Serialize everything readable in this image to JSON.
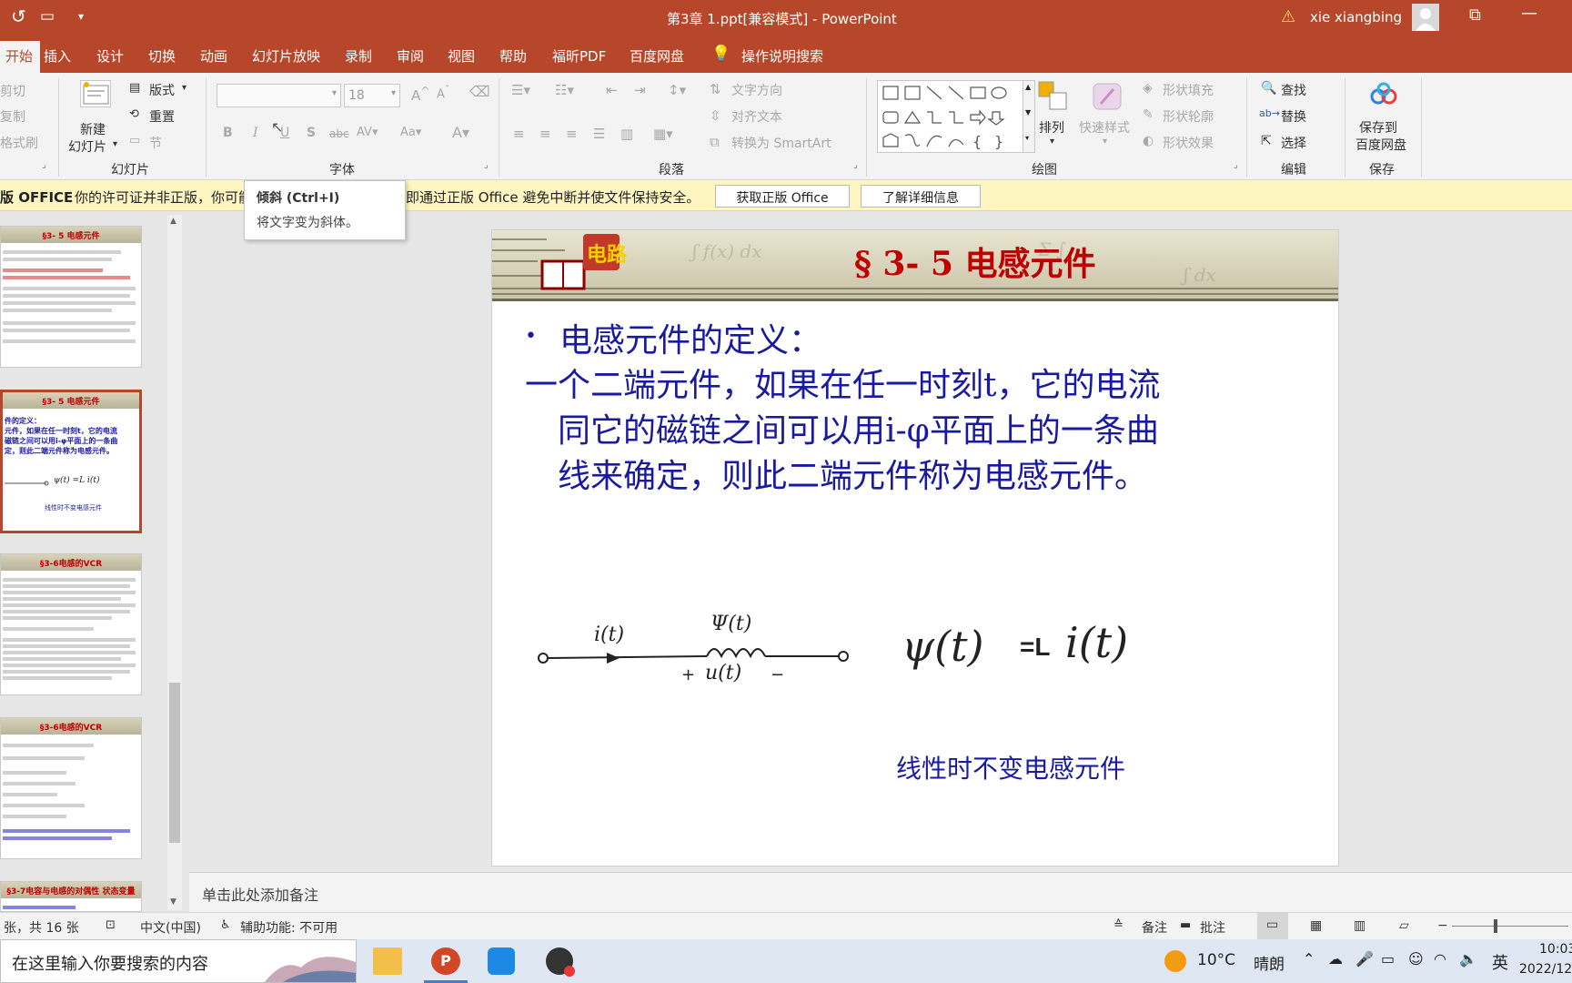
{
  "title_bar": {
    "document_title": "第3章 1.ppt[兼容模式]  -  PowerPoint",
    "user": "xie xiangbing"
  },
  "tabs": [
    "开始",
    "插入",
    "设计",
    "切换",
    "动画",
    "幻灯片放映",
    "录制",
    "审阅",
    "视图",
    "帮助",
    "福昕PDF",
    "百度网盘",
    "操作说明搜索"
  ],
  "ribbon": {
    "clipboard": {
      "cut": "剪切",
      "copy": "复制",
      "format_painter": "格式刷"
    },
    "slides": {
      "new_slide_1": "新建",
      "new_slide_2": "幻灯片",
      "layout": "版式",
      "reset": "重置",
      "section": "节",
      "group_label": "幻灯片"
    },
    "font": {
      "size": "18",
      "group_label": "字体"
    },
    "paragraph": {
      "text_direction": "文字方向",
      "align_text": "对齐文本",
      "smartart": "转换为 SmartArt",
      "group_label": "段落"
    },
    "drawing": {
      "arrange": "排列",
      "quick_styles": "快速样式",
      "shape_fill": "形状填充",
      "shape_outline": "形状轮廓",
      "shape_effects": "形状效果",
      "group_label": "绘图"
    },
    "editing": {
      "find": "查找",
      "replace": "替换",
      "select": "选择",
      "group_label": "编辑"
    },
    "save": {
      "save_to_1": "保存到",
      "save_to_2": "百度网盘",
      "group_label": "保存"
    }
  },
  "license_bar": {
    "label": "版 OFFICE",
    "message_a": "你的许可证并非正版，你可能",
    "message_b": "即通过正版 Office 避免中断并使文件保持安全。",
    "get_genuine": "获取正版 Office",
    "learn_more": "了解详细信息"
  },
  "tooltip": {
    "title": "倾斜 (Ctrl+I)",
    "desc": "将文字变为斜体。"
  },
  "thumbnails": [
    {
      "title": "§3- 5 电感元件"
    },
    {
      "title": "§3- 5 电感元件",
      "l1": "件的定义：",
      "l2": "元件，如果在任一时刻t，它的电流",
      "l3": "磁链之间可以用i-φ平面上的一条曲",
      "l4": "定，则此二端元件称为电感元件。",
      "formula": "ψ(t) =L i(t)",
      "caption": "线性时不变电感元件"
    },
    {
      "title": "§3-6电感的VCR"
    },
    {
      "title": "§3-6电感的VCR"
    },
    {
      "title": "§3-7电容与电感的对偶性 状态变量"
    }
  ],
  "slide": {
    "title": "§ 3- 5 电感元件",
    "bullet": "电感元件的定义：",
    "para_line1": "一个二端元件，如果在任一时刻t，它的电流",
    "para_line2": "同它的磁链之间可以用i-φ平面上的一条曲",
    "para_line3": "线来确定，则此二端元件称为电感元件。",
    "circuit": {
      "current": "i(t)",
      "flux": "Ψ(t)",
      "voltage": "u(t)",
      "plus": "+",
      "minus": "−"
    },
    "formula": {
      "lhs": "ψ(t)",
      "op": "=L",
      "rhs": "i(t)"
    },
    "caption": "线性时不变电感元件"
  },
  "notes_placeholder": "单击此处添加备注",
  "status_bar": {
    "slide_count": "张，共 16 张",
    "language": "中文(中国)",
    "accessibility": "辅助功能: 不可用",
    "notes": "备注",
    "comments": "批注"
  },
  "taskbar": {
    "search_placeholder": "在这里输入你要搜索的内容",
    "weather_temp": "10°C",
    "weather_desc": "晴朗",
    "ime": "英",
    "time": "10:03",
    "date": "2022/12"
  },
  "colors": {
    "accent": "#b7472a",
    "slide_blue": "#1a1aa0",
    "slide_red": "#c00000"
  }
}
